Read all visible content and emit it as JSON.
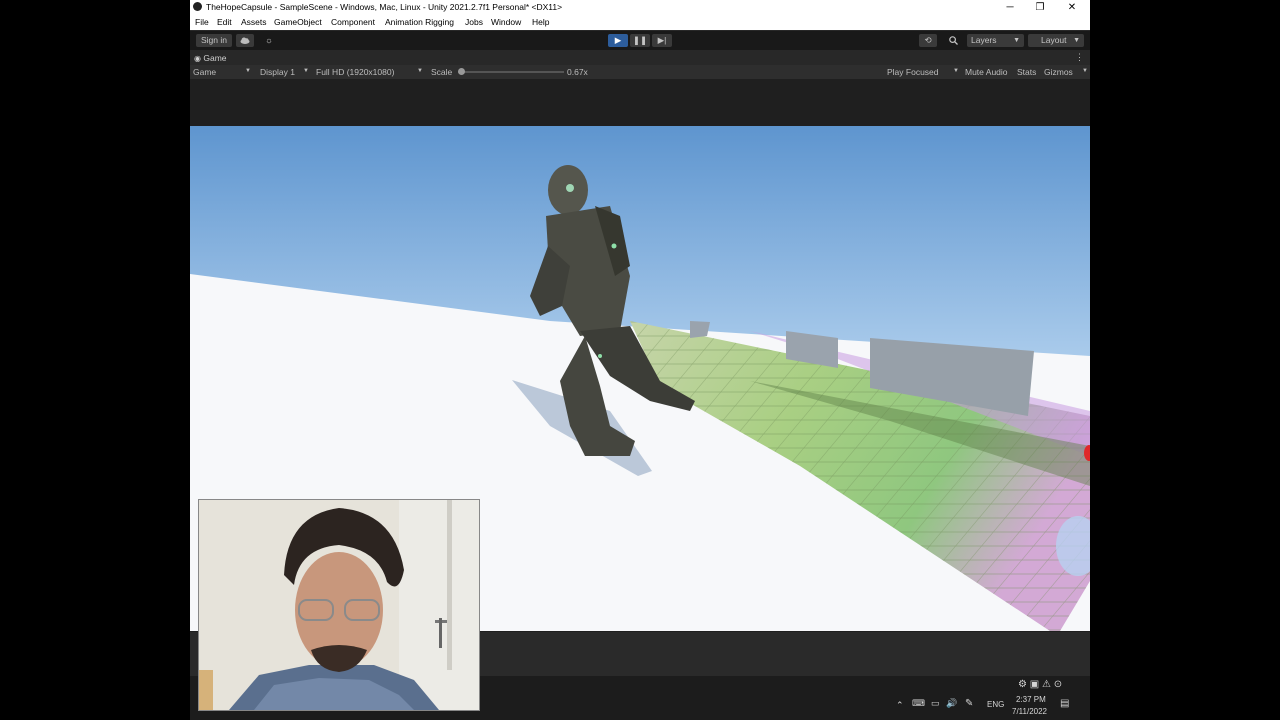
{
  "window": {
    "title": "TheHopeCapsule - SampleScene - Windows, Mac, Linux - Unity 2021.2.7f1 Personal* <DX11>",
    "controls": {
      "minimize": "─",
      "restore": "❐",
      "close": "✕"
    }
  },
  "menu": [
    "File",
    "Edit",
    "Assets",
    "GameObject",
    "Component",
    "Animation Rigging",
    "Jobs",
    "Window",
    "Help"
  ],
  "toolbar": {
    "sign_in": "Sign in",
    "play": "▶",
    "pause": "❚❚",
    "step": "▶|",
    "layers": "Layers",
    "layout": "Layout"
  },
  "game_tab": {
    "label": "Game"
  },
  "game_bar": {
    "view_mode": "Game",
    "display": "Display 1",
    "resolution": "Full HD (1920x1080)",
    "scale_label": "Scale",
    "scale_value": "0.67x",
    "play_focused": "Play Focused",
    "mute_audio": "Mute Audio",
    "stats": "Stats",
    "gizmos": "Gizmos"
  },
  "taskbar": {
    "language": "ENG",
    "time": "2:37 PM",
    "date": "7/11/2022"
  },
  "colors": {
    "play_active": "#2d5d9c",
    "editor_bg": "#282828",
    "sky_top": "#5e95cf",
    "sky_bottom": "#dfeefb"
  }
}
